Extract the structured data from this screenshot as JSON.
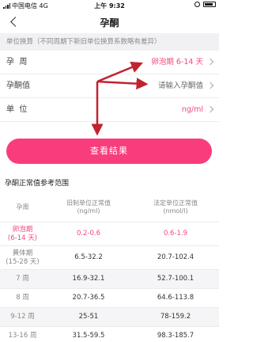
{
  "status_bar": {
    "carrier": "中国电信  4G",
    "time": "上午 9:32"
  },
  "nav": {
    "title": "孕酮"
  },
  "note": "单位换算（不同周期下新旧单位换算系数略有差异）",
  "form": {
    "rows": [
      {
        "label": "孕  周",
        "value": "卵泡期 6-14 天"
      },
      {
        "label": "孕酮值",
        "placeholder": "请输入孕酮值"
      },
      {
        "label": "单  位",
        "value": "ng/ml"
      }
    ]
  },
  "submit_label": "查看结果",
  "reference": {
    "title": "孕酮正常值参考范围",
    "headers": [
      "孕周",
      "旧制单位正常值\n(ng/ml)",
      "法定单位正常值\n(nmol/l)"
    ],
    "rows": [
      {
        "week": "卵泡期\n(6-14 天)",
        "old": "0.2-0.6",
        "new": "0.6-1.9"
      },
      {
        "week": "黄体期\n(15-28 天)",
        "old": "6.5-32.2",
        "new": "20.7-102.4"
      },
      {
        "week": "7 周",
        "old": "16.9-32.1",
        "new": "52.7-100.1"
      },
      {
        "week": "8 周",
        "old": "20.7-36.5",
        "new": "64.6-113.8"
      },
      {
        "week": "9-12 周",
        "old": "25-51",
        "new": "78-159.2"
      },
      {
        "week": "13-16 周",
        "old": "31.5-59.5",
        "new": "98.3-185.7"
      }
    ]
  },
  "colors": {
    "accent": "#f93d7c",
    "annotation_arrow": "#c0232f"
  }
}
